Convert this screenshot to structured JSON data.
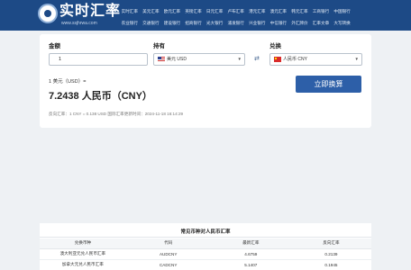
{
  "brand": {
    "name": "实时汇率",
    "url": "www.ssjhrwa.com"
  },
  "nav": {
    "row1": [
      "实时汇率",
      "美元汇率",
      "欧元汇率",
      "英镑汇率",
      "日元汇率",
      "卢布汇率",
      "港元汇率",
      "澳元汇率",
      "韩元汇率",
      "工商银行",
      "中国银行"
    ],
    "row2": [
      "农业银行",
      "交通银行",
      "建设银行",
      "招商银行",
      "光大银行",
      "浦发银行",
      "兴业银行",
      "中信银行",
      "外汇牌价",
      "汇率文章",
      "大写转换"
    ]
  },
  "converter": {
    "amount_label": "金额",
    "amount_value": "1",
    "from_label": "持有",
    "from_value": "美元 USD",
    "to_label": "兑换",
    "to_value": "人民币 CNY",
    "swap_icon": "⇄",
    "rate_line": "1 美元（USD）=",
    "result": "7.2438 人民币（CNY）",
    "convert_label": "立即换算",
    "reverse_line": "反向汇率：1 CNY = 0.138 USD   国际汇率更新时间：2024-11-18 16:14:29"
  },
  "table": {
    "title": "常见币种对人民币汇率",
    "headers": [
      "兑换币种",
      "代码",
      "最新汇率",
      "反向汇率"
    ],
    "rows": [
      [
        "澳大利亚元兑人民币汇率",
        "AUDCNY",
        "4.6759",
        "0.2139"
      ],
      [
        "加拿大元兑人民币汇率",
        "CADCNY",
        "5.1407",
        "0.1945"
      ]
    ]
  },
  "colors": {
    "header_bg": "#1d4a86",
    "button_bg": "#2d5fa8",
    "page_bg": "#eef1f4"
  }
}
